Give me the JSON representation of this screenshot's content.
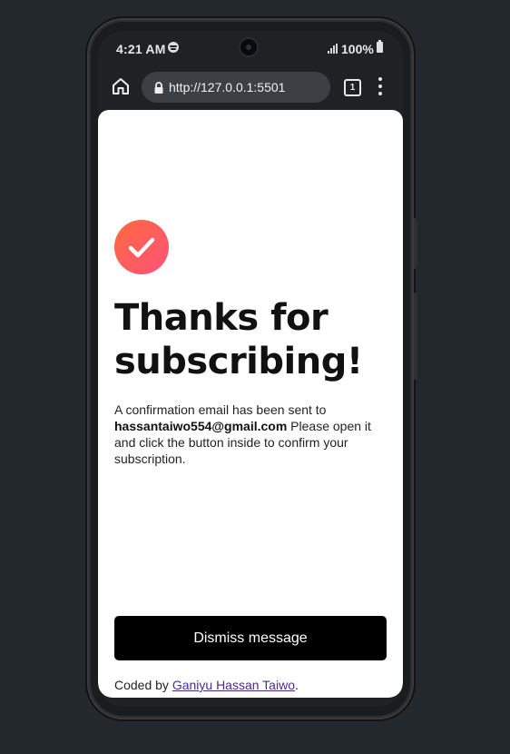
{
  "status_bar": {
    "time": "4:21 AM",
    "battery": "100%"
  },
  "browser": {
    "url": "http://127.0.0.1:5501",
    "tab_count": "1"
  },
  "card": {
    "title": "Thanks for subscribing!",
    "message_before": "A confirmation email has been sent to ",
    "email": "hassantaiwo554@gmail.com",
    "message_after": " Please open it and click the button inside to confirm your subscription.",
    "button_label": "Dismiss message",
    "credit_prefix": "Coded by ",
    "credit_author": "Ganiyu Hassan Taiwo",
    "credit_suffix": "."
  },
  "colors": {
    "icon_gradient_start": "#ff6a3d",
    "icon_gradient_end": "#ff527b",
    "button_bg": "#000000",
    "page_bg": "#23282d"
  },
  "icons": {
    "status": [
      "spotify-icon",
      "signal-icon",
      "battery-icon"
    ],
    "browser": [
      "home-icon",
      "lock-icon",
      "tabs-icon",
      "menu-icon"
    ],
    "card": "checkmark-icon"
  }
}
